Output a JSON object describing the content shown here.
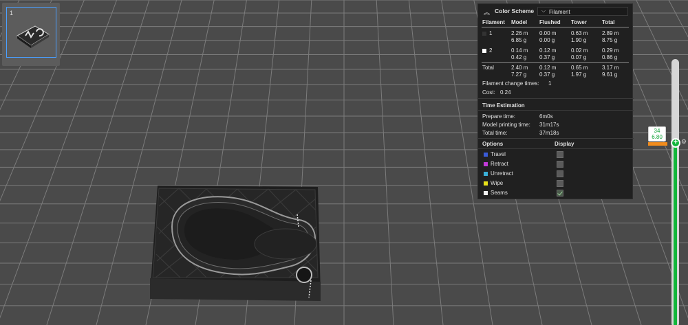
{
  "plate": {
    "number": "1"
  },
  "legend": {
    "title": "Color Scheme",
    "scheme_value": "Filament",
    "headers": [
      "Filament",
      "Model",
      "Flushed",
      "Tower",
      "Total"
    ],
    "rows": [
      {
        "id": "1",
        "color": "#333333",
        "model": [
          "2.26 m",
          "6.85 g"
        ],
        "flushed": [
          "0.00 m",
          "0.00 g"
        ],
        "tower": [
          "0.63 m",
          "1.90 g"
        ],
        "total": [
          "2.89 m",
          "8.75 g"
        ]
      },
      {
        "id": "2",
        "color": "#ffffff",
        "model": [
          "0.14 m",
          "0.42 g"
        ],
        "flushed": [
          "0.12 m",
          "0.37 g"
        ],
        "tower": [
          "0.02 m",
          "0.07 g"
        ],
        "total": [
          "0.29 m",
          "0.86 g"
        ]
      }
    ],
    "total_row": {
      "label": "Total",
      "model": [
        "2.40 m",
        "7.27 g"
      ],
      "flushed": [
        "0.12 m",
        "0.37 g"
      ],
      "tower": [
        "0.65 m",
        "1.97 g"
      ],
      "total": [
        "3.17 m",
        "9.61 g"
      ]
    },
    "change_times_label": "Filament change times:",
    "change_times_value": "1",
    "cost_label": "Cost:",
    "cost_value": "0.24",
    "time_title": "Time Estimation",
    "prepare_label": "Prepare time:",
    "prepare_value": "6m0s",
    "model_time_label": "Model printing time:",
    "model_time_value": "31m17s",
    "total_time_label": "Total time:",
    "total_time_value": "37m18s",
    "options_header": "Options",
    "display_header": "Display",
    "options": [
      {
        "label": "Travel",
        "color": "#3a5bd8",
        "checked": false
      },
      {
        "label": "Retract",
        "color": "#c23ad8",
        "checked": false
      },
      {
        "label": "Unretract",
        "color": "#3ab0d8",
        "checked": false
      },
      {
        "label": "Wipe",
        "color": "#e8e21a",
        "checked": false
      },
      {
        "label": "Seams",
        "color": "#f0f0f0",
        "checked": true
      }
    ]
  },
  "layer_slider": {
    "layer": "34",
    "height": "6.80",
    "accent": "#12b63a"
  },
  "icons": {
    "collapse": "chevron-up-icon",
    "dropdown": "chevron-down-icon",
    "slider_add": "plus-icon",
    "slider_settings": "gear-icon"
  }
}
